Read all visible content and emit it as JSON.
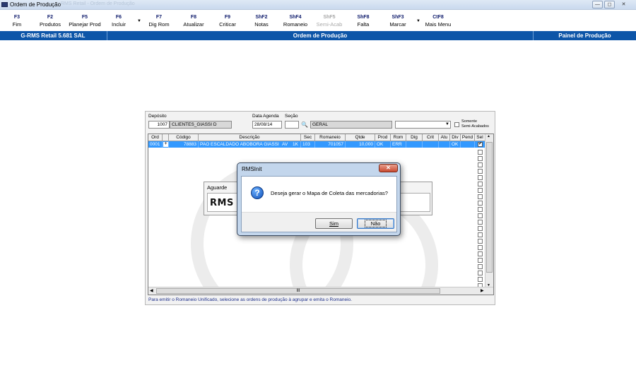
{
  "window": {
    "title": "Ordem de Produção",
    "faded_title": "RMS Retail - Ordem de Produção",
    "controls": {
      "minimize": "—",
      "restore": "◻",
      "close": "✕"
    }
  },
  "toolbar": [
    {
      "key": "F3",
      "label": "Fim",
      "enabled": true
    },
    {
      "key": "F2",
      "label": "Produtos",
      "enabled": true
    },
    {
      "key": "F5",
      "label": "Planejar Prod",
      "enabled": true
    },
    {
      "key": "F6",
      "label": "Incluir",
      "enabled": true,
      "has_dropdown": true
    },
    {
      "key": "F7",
      "label": "Dig Rom",
      "enabled": true
    },
    {
      "key": "F8",
      "label": "Atualizar",
      "enabled": true
    },
    {
      "key": "F9",
      "label": "Criticar",
      "enabled": true
    },
    {
      "key": "ShF2",
      "label": "Notas",
      "enabled": true
    },
    {
      "key": "ShF4",
      "label": "Romaneio",
      "enabled": true
    },
    {
      "key": "ShF5",
      "label": "Semi-Acab",
      "enabled": false
    },
    {
      "key": "ShF8",
      "label": "Falta",
      "enabled": true
    },
    {
      "key": "ShF3",
      "label": "Marcar",
      "enabled": true,
      "has_dropdown": true
    },
    {
      "key": "CtF8",
      "label": "Mais Menu",
      "enabled": true
    }
  ],
  "header_bar": {
    "left": "G-RMS Retail 5.681 SAL",
    "center": "Ordem de Produção",
    "right": "Painel de Produção"
  },
  "form": {
    "deposito_label": "Depósito",
    "deposito_code": "1007",
    "deposito_name": "CLIENTES_GIASSI D",
    "data_agenda_label": "Data Agenda",
    "data_agenda_value": "28/08/14",
    "secao_label": "Seção",
    "secao_value": "",
    "secao_name": "GERAL",
    "filter_value": "",
    "somente_label_1": "Somente",
    "somente_label_2": "Semi-Acabados"
  },
  "grid": {
    "columns": [
      "Ord",
      "Código",
      "Descrição",
      "Sec",
      "Romaneio",
      "Qtde",
      "Prod",
      "Rom",
      "Dig",
      "Crit",
      "Atu",
      "Div",
      "Pend",
      "Sel"
    ],
    "rows": [
      {
        "ord": "0001",
        "expand": "+",
        "codigo": "78883",
        "descricao": "PAO ESCALDADO ABOBORA GIASSI",
        "unidade": "AV",
        "emb": "1K",
        "sec": "103",
        "romaneio": "701057",
        "qtde": "10,000",
        "prod": "OK",
        "rom": "ERR",
        "dig": "",
        "crit": "",
        "atu": "",
        "div": "OK",
        "pend": "",
        "sel": "✔"
      }
    ],
    "scroll_mark": "III"
  },
  "hint": "Para emitir o Romaneio Unificado, selecione as ordens de produção à agrupar e emita o Romaneio.",
  "aguarde": {
    "title": "Aguarde",
    "logo": "RMS"
  },
  "dialog": {
    "title": "RMSInit",
    "message": "Deseja gerar o Mapa de Coleta das mercadorias?",
    "yes_label": "Sim",
    "no_label": "Não",
    "close": "✕"
  }
}
